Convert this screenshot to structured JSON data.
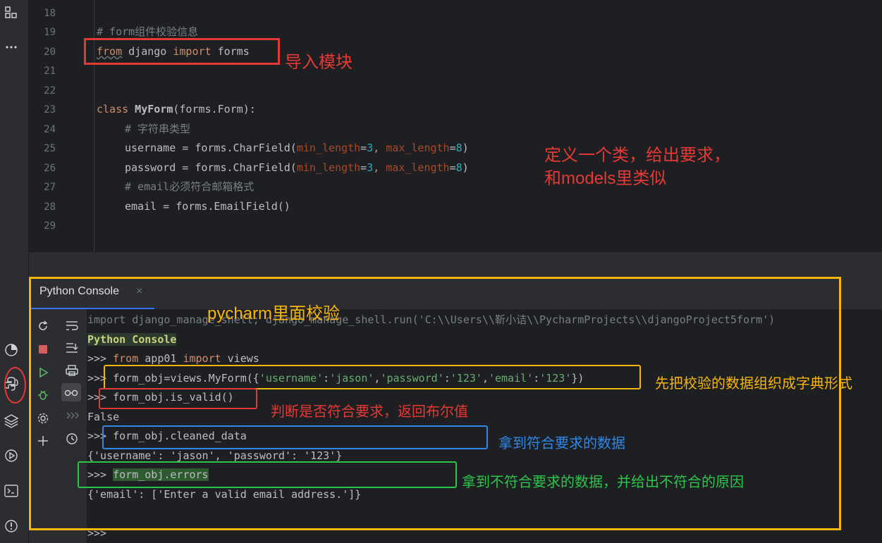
{
  "colors": {
    "red": "#e53935",
    "orange": "#f5b50a",
    "blue": "#2f87e6",
    "green": "#2ec34a"
  },
  "sidebar": {
    "icons": [
      "grid-icon",
      "more-icon",
      "profile-icon",
      "stop-icon",
      "run-icon",
      "debug-icon",
      "python-console-icon",
      "layers-icon",
      "services-icon",
      "terminal-icon",
      "problems-icon"
    ]
  },
  "editor": {
    "line_numbers": [
      "18",
      "19",
      "20",
      "21",
      "22",
      "23",
      "24",
      "25",
      "26",
      "27",
      "28",
      "29"
    ],
    "lines": {
      "l19": "# form组件校验信息",
      "l20_from": "from",
      "l20_mid": " django ",
      "l20_import": "import",
      "l20_end": " forms",
      "l23_class": "class",
      "l23_name": " MyForm",
      "l23_rest": "(forms.Form):",
      "l24": "# 字符串类型",
      "l25_a": "username = forms.CharField(",
      "l25_p1": "min_length",
      "l25_v1": "3",
      "l25_sep": ", ",
      "l25_p2": "max_length",
      "l25_v2": "8",
      "l25_end": ")",
      "l26_a": "password = forms.CharField(",
      "l27": "# email必须符合邮箱格式",
      "l28": "email = forms.EmailField()"
    }
  },
  "console": {
    "tab_label": "Python Console",
    "close_glyph": "×",
    "lines": {
      "c1": "import django_manage_shell; django_manage_shell.run('C:\\\\Users\\\\靳小诘\\\\PycharmProjects\\\\djangoProject5form')",
      "c2": "Python Console",
      "prompt": ">>> ",
      "c3_from": "from",
      "c3_mid": " app01 ",
      "c3_import": "import",
      "c3_end": " views",
      "c4_a": "form_obj=views.MyForm({",
      "c4_k1": "'username'",
      "c4_v1": "'jason'",
      "c4_k2": "'password'",
      "c4_v2": "'123'",
      "c4_k3": "'email'",
      "c4_v3": "'123'",
      "c4_end": "})",
      "c5": "form_obj.is_valid()",
      "c6": "False",
      "c7": "form_obj.cleaned_data",
      "c8": "{'username': 'jason', 'password': '123'}",
      "c9": "form_obj.errors",
      "c10": "{'email': ['Enter a valid email address.']}",
      "c11": ">>>"
    }
  },
  "annotations": {
    "import_module": "导入模块",
    "define_class_1": "定义一个类，给出要求，",
    "define_class_2": "和models里类似",
    "pycharm_check": "pycharm里面校验",
    "dict_form": "先把校验的数据组织成字典形式",
    "is_valid_note": "判断是否符合要求，返回布尔值",
    "cleaned_note": "拿到符合要求的数据",
    "errors_note": "拿到不符合要求的数据，并给出不符合的原因"
  }
}
